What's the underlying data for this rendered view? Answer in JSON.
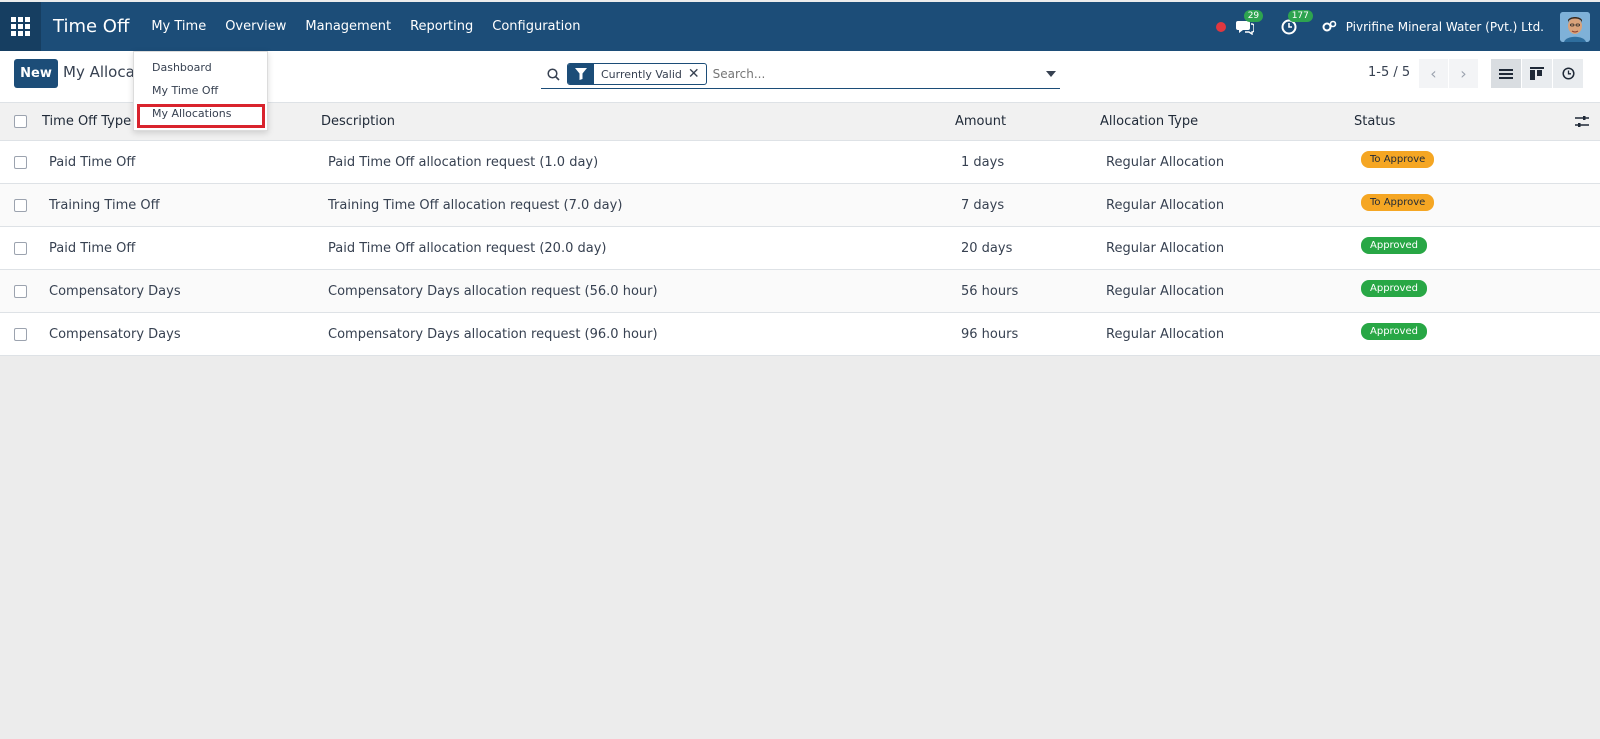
{
  "app": {
    "title": "Time Off"
  },
  "menu": [
    "My Time",
    "Overview",
    "Management",
    "Reporting",
    "Configuration"
  ],
  "nav_right": {
    "messages_count": "29",
    "activities_count": "177",
    "company": "Pivrifine Mineral Water (Pvt.) Ltd."
  },
  "control": {
    "new_label": "New",
    "breadcrumb": "My Allocations",
    "search": {
      "facet": "Currently Valid",
      "placeholder": "Search..."
    },
    "pager": "1-5 / 5"
  },
  "dropdown": {
    "items": [
      "Dashboard",
      "My Time Off",
      "My Allocations"
    ]
  },
  "table": {
    "headers": {
      "type": "Time Off Type",
      "description": "Description",
      "amount": "Amount",
      "allocation_type": "Allocation Type",
      "status": "Status"
    },
    "rows": [
      {
        "type": "Paid Time Off",
        "description": "Paid Time Off allocation request (1.0 day)",
        "amount": "1 days",
        "allocation_type": "Regular Allocation",
        "status": "To Approve"
      },
      {
        "type": "Training Time Off",
        "description": "Training Time Off allocation request (7.0 day)",
        "amount": "7 days",
        "allocation_type": "Regular Allocation",
        "status": "To Approve"
      },
      {
        "type": "Paid Time Off",
        "description": "Paid Time Off allocation request (20.0 day)",
        "amount": "20 days",
        "allocation_type": "Regular Allocation",
        "status": "Approved"
      },
      {
        "type": "Compensatory Days",
        "description": "Compensatory Days allocation request (56.0 hour)",
        "amount": "56 hours",
        "allocation_type": "Regular Allocation",
        "status": "Approved"
      },
      {
        "type": "Compensatory Days",
        "description": "Compensatory Days allocation request (96.0 hour)",
        "amount": "96 hours",
        "allocation_type": "Regular Allocation",
        "status": "Approved"
      }
    ]
  },
  "colors": {
    "brand": "#1c4d78",
    "to_approve": "#f5a623",
    "approved": "#28a745",
    "highlight": "#d9232d"
  },
  "icons": [
    "apps-grid-icon",
    "chat-icon",
    "clock-icon",
    "switch-company-icon",
    "search-icon",
    "filter-icon",
    "close-icon",
    "chevron-left-icon",
    "chevron-right-icon",
    "list-view-icon",
    "kanban-view-icon",
    "activity-view-icon",
    "optional-columns-icon"
  ]
}
